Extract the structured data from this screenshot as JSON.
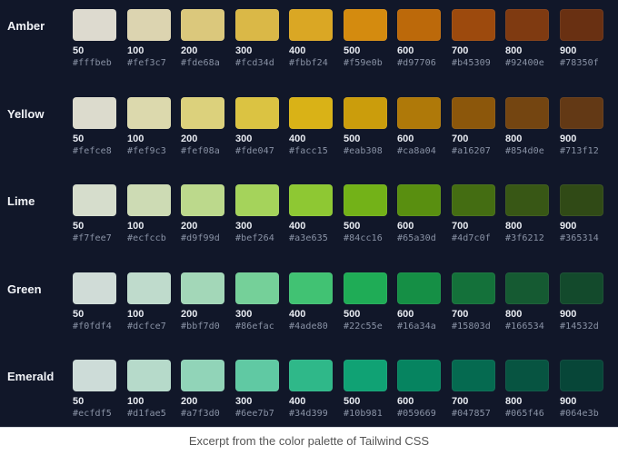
{
  "steps": [
    "50",
    "100",
    "200",
    "300",
    "400",
    "500",
    "600",
    "700",
    "800",
    "900"
  ],
  "palettes": [
    {
      "name": "Amber",
      "colors": [
        "#fffbeb",
        "#fef3c7",
        "#fde68a",
        "#fcd34d",
        "#fbbf24",
        "#f59e0b",
        "#d97706",
        "#b45309",
        "#92400e",
        "#78350f"
      ]
    },
    {
      "name": "Yellow",
      "colors": [
        "#fefce8",
        "#fef9c3",
        "#fef08a",
        "#fde047",
        "#facc15",
        "#eab308",
        "#ca8a04",
        "#a16207",
        "#854d0e",
        "#713f12"
      ]
    },
    {
      "name": "Lime",
      "colors": [
        "#f7fee7",
        "#ecfccb",
        "#d9f99d",
        "#bef264",
        "#a3e635",
        "#84cc16",
        "#65a30d",
        "#4d7c0f",
        "#3f6212",
        "#365314"
      ]
    },
    {
      "name": "Green",
      "colors": [
        "#f0fdf4",
        "#dcfce7",
        "#bbf7d0",
        "#86efac",
        "#4ade80",
        "#22c55e",
        "#16a34a",
        "#15803d",
        "#166534",
        "#14532d"
      ]
    },
    {
      "name": "Emerald",
      "colors": [
        "#ecfdf5",
        "#d1fae5",
        "#a7f3d0",
        "#6ee7b7",
        "#34d399",
        "#10b981",
        "#059669",
        "#047857",
        "#065f46",
        "#064e3b"
      ]
    }
  ],
  "caption": "Excerpt from the color palette of Tailwind CSS"
}
